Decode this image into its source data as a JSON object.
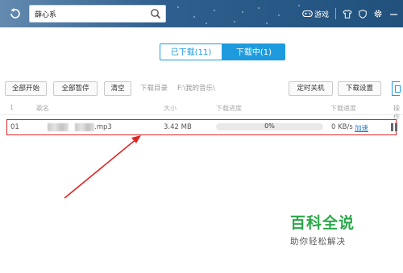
{
  "topbar": {
    "search_value": "薛心系",
    "game_label": "游戏",
    "back_icon": "back-arrow-icon",
    "icons": [
      "search-icon",
      "gamepad-icon",
      "shirt-icon",
      "gear-icon",
      "minimize-icon"
    ]
  },
  "tabs": {
    "downloaded_label": "已下载(11)",
    "downloading_label": "下载中(1)"
  },
  "toolbar": {
    "start_all": "全部开始",
    "pause_all": "全部暂停",
    "clear": "清空",
    "dir_label": "下载目录",
    "dir_path": "F:\\我的音乐\\",
    "timer_shutdown": "定时关机",
    "settings": "下载设置"
  },
  "table": {
    "headers": {
      "index": "1",
      "name": "歌名",
      "size": "大小",
      "progress": "下载进度",
      "speed": "下载速度",
      "action": "操作"
    },
    "rows": [
      {
        "index": "01",
        "name_suffix": ".mp3",
        "size": "3.42 MB",
        "progress_text": "0%",
        "progress": 0,
        "speed": "0 KB/s",
        "accelerate": "加速"
      }
    ]
  },
  "watermark": {
    "title": "百科全说",
    "subtitle": "助你轻松解决"
  },
  "colors": {
    "topbar": "#2f5f8e",
    "accent": "#1e9bde",
    "highlight": "#e02424",
    "watermark_green": "#2aa84a"
  }
}
